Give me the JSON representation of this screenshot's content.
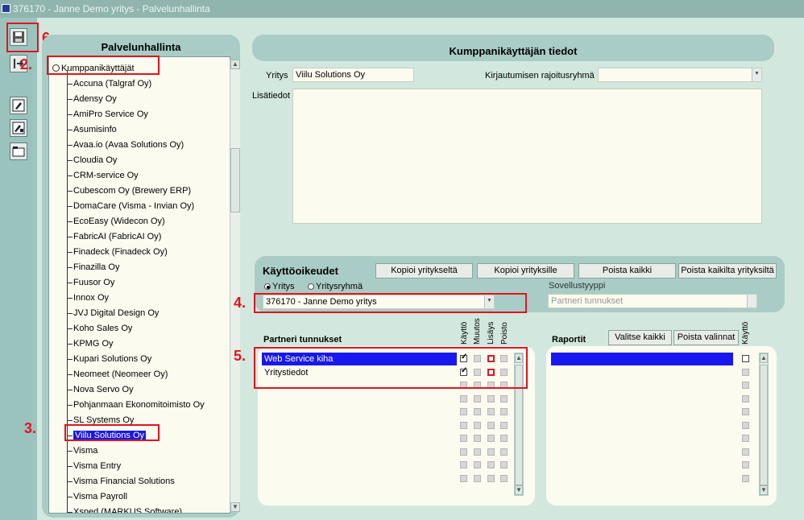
{
  "window": {
    "title": "376170 - Janne Demo yritys - Palvelunhallinta"
  },
  "markers": {
    "m6": "6.",
    "m2": "2.",
    "m3": "3.",
    "m4": "4.",
    "m5": "5."
  },
  "left_panel": {
    "title": "Palvelunhallinta",
    "tree_root": "Kumppanikäyttäjät",
    "tree_items": [
      "Accuna (Talgraf Oy)",
      "Adensy Oy",
      "AmiPro Service Oy",
      "Asumisinfo",
      "Avaa.io (Avaa Solutions Oy)",
      "Cloudia Oy",
      "CRM-service Oy",
      "Cubescom Oy (Brewery ERP)",
      "DomaCare (Visma - Invian Oy)",
      "EcoEasy (Widecon Oy)",
      "FabricAI (FabricAI Oy)",
      "Finadeck (Finadeck Oy)",
      "Finazilla Oy",
      "Fuusor Oy",
      "Innox Oy",
      "JVJ Digital Design Oy",
      "Koho Sales Oy",
      "KPMG Oy",
      "Kupari Solutions Oy",
      "Neomeet (Neomeer Oy)",
      "Nova Servo Oy",
      "Pohjanmaan Ekonomitoimisto Oy",
      "SL Systems Oy",
      "Viilu Solutions Oy",
      "Visma",
      "Visma Entry",
      "Visma Financial Solutions",
      "Visma Payroll",
      "Xsped (MARKUS Software)"
    ],
    "selected_index": 23
  },
  "partner_info": {
    "heading": "Kumppanikäyttäjän tiedot",
    "company_label": "Yritys",
    "company_value": "Viilu Solutions Oy",
    "login_group_label": "Kirjautumisen rajoitusryhmä",
    "login_group_value": "",
    "notes_label": "Lisätiedot",
    "notes_value": ""
  },
  "rights": {
    "title": "Käyttöoikeudet",
    "buttons": [
      "Kopioi yritykseltä",
      "Kopioi yrityksille",
      "Poista kaikki",
      "Poista kaikilta yrityksiltä"
    ],
    "radio_company": "Yritys",
    "radio_group": "Yritysryhmä",
    "company_select": "376170 - Janne Demo yritys",
    "app_type_label": "Sovellustyyppi",
    "app_type_value": "Partneri tunnukset"
  },
  "partner_codes": {
    "heading": "Partneri tunnukset",
    "col_headers": [
      "Käyttö",
      "Muutos",
      "Lisäys",
      "Poisto"
    ],
    "rows": [
      "Web Service kiha",
      "Yritystiedot"
    ]
  },
  "reports": {
    "heading": "Raportit",
    "select_all": "Valitse kaikki",
    "remove_selected": "Poista valinnat",
    "col_header": "Käyttö"
  },
  "colors": {
    "accent_red": "#e0141e",
    "selection_blue": "#1818ee",
    "panel": "#a9cdc6"
  }
}
